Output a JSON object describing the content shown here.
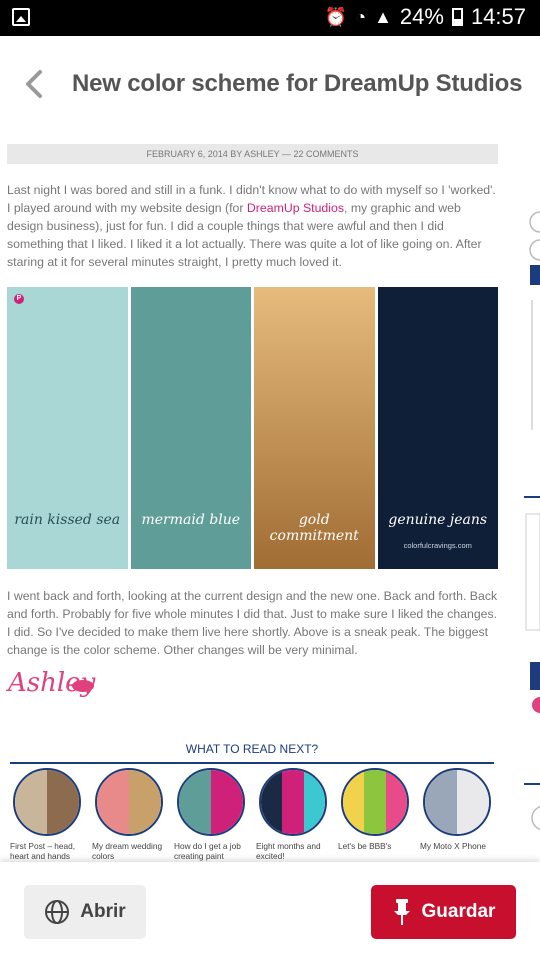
{
  "status_bar": {
    "battery": "24%",
    "time": "14:57"
  },
  "header": {
    "title": "New color scheme for DreamUp Studios"
  },
  "post": {
    "meta": "February 6, 2014 by Ashley — 22 Comments",
    "para1_before": "Last night I was bored and still in a funk. I didn't know what to do with myself so I 'worked'. I played around with my website design (for ",
    "para1_link": "DreamUp Studios",
    "para1_after": ", my graphic and web design business), just for fun. I did a couple things that were awful and then I did something that I liked. I liked it a lot actually. There was quite a lot of like going on. After staring at it for several minutes straight, I pretty much loved it.",
    "para2": "I went back and forth, looking at the current design and the new one. Back and forth. Back and forth. Probably for five whole minutes I did that. Just to make sure I liked the changes. I did. So I've decided to make them live here shortly. Above is a sneak peak. The biggest change is the color scheme. Other changes will be very minimal.",
    "signature": "Ashley"
  },
  "palette": {
    "swatches": [
      {
        "name": "rain kissed sea",
        "color": "#a8d7d6",
        "text_color": "#2b4e55"
      },
      {
        "name": "mermaid blue",
        "color": "#5f9e98",
        "text_color": "#ffffff"
      },
      {
        "name": "gold commitment",
        "color_top": "#e6bb7c",
        "color_bottom": "#a06d34",
        "text_color": "#ffffff"
      },
      {
        "name": "genuine jeans",
        "color": "#0f1f38",
        "text_color": "#ffffff"
      }
    ],
    "credit": "colorfulcravings.com"
  },
  "related": {
    "heading": "What to read next?",
    "items": [
      {
        "label": "First Post – head, heart and hands"
      },
      {
        "label": "My dream wedding colors"
      },
      {
        "label": "How do I get a job creating paint colors?"
      },
      {
        "label": "Eight months and excited!"
      },
      {
        "label": "Let's be BBB's"
      },
      {
        "label": "My Moto X Phone"
      }
    ]
  },
  "actions": {
    "open_label": "Abrir",
    "save_label": "Guardar"
  },
  "colors": {
    "accent": "#c8102e",
    "link": "#d0217a",
    "navy": "#1d3c7d"
  }
}
